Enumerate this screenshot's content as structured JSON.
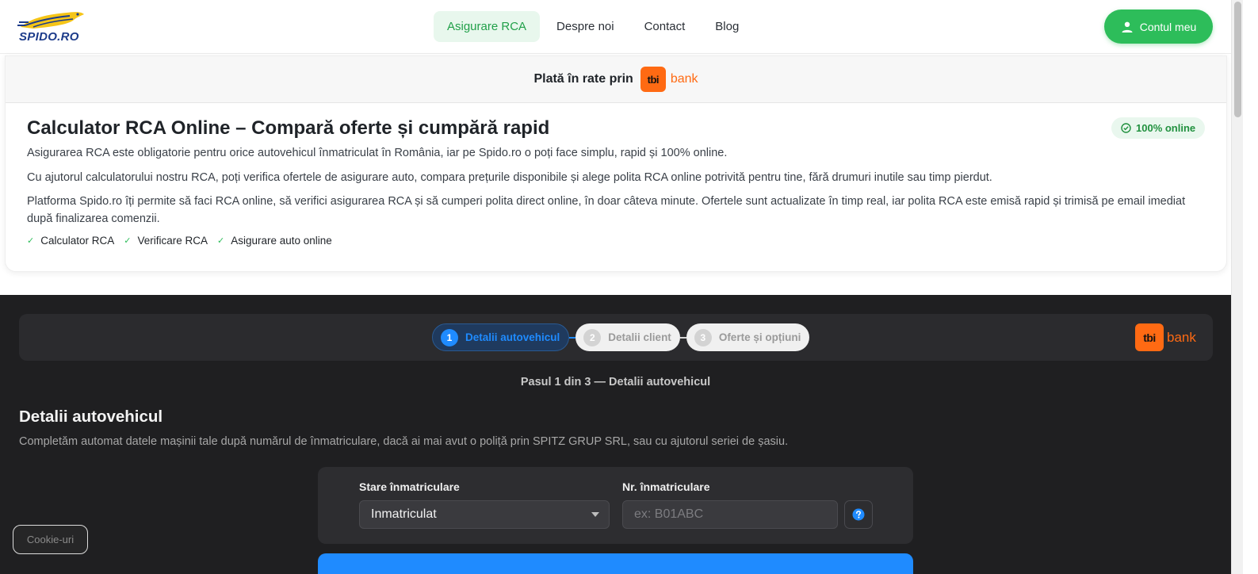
{
  "header": {
    "logo_text": "SPIDO.RO",
    "nav": [
      {
        "label": "Asigurare RCA",
        "active": true
      },
      {
        "label": "Despre noi",
        "active": false
      },
      {
        "label": "Contact",
        "active": false
      },
      {
        "label": "Blog",
        "active": false
      }
    ],
    "account_label": "Contul meu",
    "account_icon": "user-icon"
  },
  "bank_strip": {
    "label": "Plată în rate prin",
    "bank_logo": "tbi",
    "bank_word": "bank"
  },
  "intro": {
    "title": "Calculator RCA Online – Compară oferte și cumpără rapid",
    "badge": "100% online",
    "paragraphs": [
      "Asigurarea RCA este obligatorie pentru orice autovehicul înmatriculat în România, iar pe Spido.ro o poți face simplu, rapid și 100% online.",
      "Cu ajutorul calculatorului nostru RCA, poți verifica ofertele de asigurare auto, compara prețurile disponibile și alege polita RCA online potrivită pentru tine, fără drumuri inutile sau timp pierdut.",
      "Platforma Spido.ro îți permite să faci RCA online, să verifici asigurarea RCA și să cumperi polita direct online, în doar câteva minute. Ofertele sunt actualizate în timp real, iar polita RCA este emisă rapid și trimisă pe email imediat după finalizarea comenzii."
    ],
    "tags": [
      "Calculator RCA",
      "Verificare RCA",
      "Asigurare auto online"
    ]
  },
  "wizard": {
    "steps": [
      {
        "num": "1",
        "label": "Detalii autovehicul",
        "active": true
      },
      {
        "num": "2",
        "label": "Detalii client",
        "active": false
      },
      {
        "num": "3",
        "label": "Oferte și opțiuni",
        "active": false
      }
    ],
    "bank_logo": "tbi",
    "bank_word": "bank",
    "caption": "Pasul 1 din 3 — Detalii autovehicul",
    "section_title": "Detalii autovehicul",
    "section_subtitle": "Completăm automat datele mașinii tale după numărul de înmatriculare, dacă ai mai avut o poliță prin SPITZ GRUP SRL, sau cu ajutorul seriei de șasiu.",
    "form": {
      "status_label": "Stare înmatriculare",
      "status_value": "Inmatriculat",
      "plate_label": "Nr. înmatriculare",
      "plate_value": "",
      "plate_placeholder": "ex: B01ABC",
      "help_icon": "question-circle-icon"
    }
  },
  "cookie_label": "Cookie-uri",
  "colors": {
    "brand_green": "#2dbd5a",
    "brand_blue": "#1f8bff",
    "tbi_orange": "#ff6a13",
    "dark_bg": "#1f1f21"
  }
}
